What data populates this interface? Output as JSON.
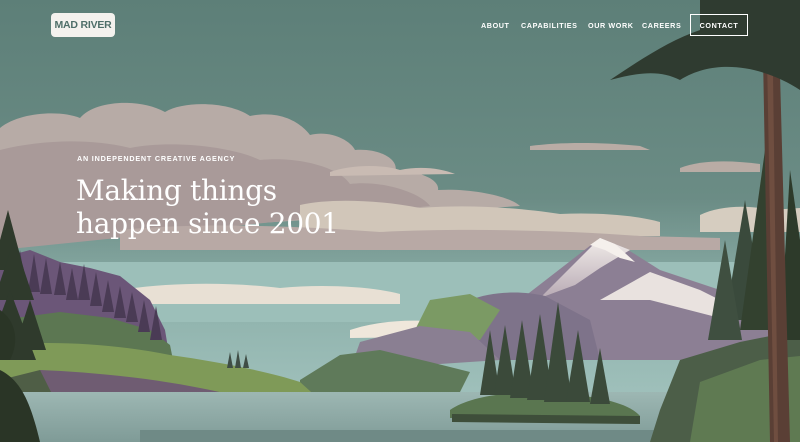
{
  "brand": {
    "logo_text": "MAD RIVER"
  },
  "nav": {
    "items": [
      {
        "label": "ABOUT"
      },
      {
        "label": "CAPABILITIES"
      },
      {
        "label": "OUR WORK"
      },
      {
        "label": "CAREERS"
      }
    ],
    "contact_label": "CONTACT"
  },
  "hero": {
    "eyebrow": "AN INDEPENDENT CREATIVE AGENCY",
    "headline_line1": "Making things",
    "headline_line2": "happen since 2001"
  },
  "colors": {
    "sky": "#5f8279",
    "logo_bg": "#f4f2ee",
    "logo_text": "#4f6f69",
    "text": "#ffffff"
  }
}
